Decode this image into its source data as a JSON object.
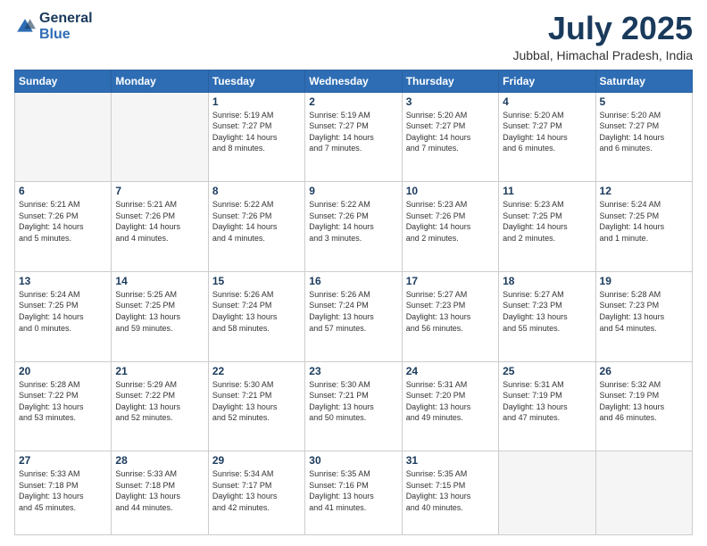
{
  "header": {
    "logo_line1": "General",
    "logo_line2": "Blue",
    "month": "July 2025",
    "location": "Jubbal, Himachal Pradesh, India"
  },
  "weekdays": [
    "Sunday",
    "Monday",
    "Tuesday",
    "Wednesday",
    "Thursday",
    "Friday",
    "Saturday"
  ],
  "weeks": [
    [
      {
        "day": "",
        "info": ""
      },
      {
        "day": "",
        "info": ""
      },
      {
        "day": "1",
        "info": "Sunrise: 5:19 AM\nSunset: 7:27 PM\nDaylight: 14 hours\nand 8 minutes."
      },
      {
        "day": "2",
        "info": "Sunrise: 5:19 AM\nSunset: 7:27 PM\nDaylight: 14 hours\nand 7 minutes."
      },
      {
        "day": "3",
        "info": "Sunrise: 5:20 AM\nSunset: 7:27 PM\nDaylight: 14 hours\nand 7 minutes."
      },
      {
        "day": "4",
        "info": "Sunrise: 5:20 AM\nSunset: 7:27 PM\nDaylight: 14 hours\nand 6 minutes."
      },
      {
        "day": "5",
        "info": "Sunrise: 5:20 AM\nSunset: 7:27 PM\nDaylight: 14 hours\nand 6 minutes."
      }
    ],
    [
      {
        "day": "6",
        "info": "Sunrise: 5:21 AM\nSunset: 7:26 PM\nDaylight: 14 hours\nand 5 minutes."
      },
      {
        "day": "7",
        "info": "Sunrise: 5:21 AM\nSunset: 7:26 PM\nDaylight: 14 hours\nand 4 minutes."
      },
      {
        "day": "8",
        "info": "Sunrise: 5:22 AM\nSunset: 7:26 PM\nDaylight: 14 hours\nand 4 minutes."
      },
      {
        "day": "9",
        "info": "Sunrise: 5:22 AM\nSunset: 7:26 PM\nDaylight: 14 hours\nand 3 minutes."
      },
      {
        "day": "10",
        "info": "Sunrise: 5:23 AM\nSunset: 7:26 PM\nDaylight: 14 hours\nand 2 minutes."
      },
      {
        "day": "11",
        "info": "Sunrise: 5:23 AM\nSunset: 7:25 PM\nDaylight: 14 hours\nand 2 minutes."
      },
      {
        "day": "12",
        "info": "Sunrise: 5:24 AM\nSunset: 7:25 PM\nDaylight: 14 hours\nand 1 minute."
      }
    ],
    [
      {
        "day": "13",
        "info": "Sunrise: 5:24 AM\nSunset: 7:25 PM\nDaylight: 14 hours\nand 0 minutes."
      },
      {
        "day": "14",
        "info": "Sunrise: 5:25 AM\nSunset: 7:25 PM\nDaylight: 13 hours\nand 59 minutes."
      },
      {
        "day": "15",
        "info": "Sunrise: 5:26 AM\nSunset: 7:24 PM\nDaylight: 13 hours\nand 58 minutes."
      },
      {
        "day": "16",
        "info": "Sunrise: 5:26 AM\nSunset: 7:24 PM\nDaylight: 13 hours\nand 57 minutes."
      },
      {
        "day": "17",
        "info": "Sunrise: 5:27 AM\nSunset: 7:23 PM\nDaylight: 13 hours\nand 56 minutes."
      },
      {
        "day": "18",
        "info": "Sunrise: 5:27 AM\nSunset: 7:23 PM\nDaylight: 13 hours\nand 55 minutes."
      },
      {
        "day": "19",
        "info": "Sunrise: 5:28 AM\nSunset: 7:23 PM\nDaylight: 13 hours\nand 54 minutes."
      }
    ],
    [
      {
        "day": "20",
        "info": "Sunrise: 5:28 AM\nSunset: 7:22 PM\nDaylight: 13 hours\nand 53 minutes."
      },
      {
        "day": "21",
        "info": "Sunrise: 5:29 AM\nSunset: 7:22 PM\nDaylight: 13 hours\nand 52 minutes."
      },
      {
        "day": "22",
        "info": "Sunrise: 5:30 AM\nSunset: 7:21 PM\nDaylight: 13 hours\nand 52 minutes."
      },
      {
        "day": "23",
        "info": "Sunrise: 5:30 AM\nSunset: 7:21 PM\nDaylight: 13 hours\nand 50 minutes."
      },
      {
        "day": "24",
        "info": "Sunrise: 5:31 AM\nSunset: 7:20 PM\nDaylight: 13 hours\nand 49 minutes."
      },
      {
        "day": "25",
        "info": "Sunrise: 5:31 AM\nSunset: 7:19 PM\nDaylight: 13 hours\nand 47 minutes."
      },
      {
        "day": "26",
        "info": "Sunrise: 5:32 AM\nSunset: 7:19 PM\nDaylight: 13 hours\nand 46 minutes."
      }
    ],
    [
      {
        "day": "27",
        "info": "Sunrise: 5:33 AM\nSunset: 7:18 PM\nDaylight: 13 hours\nand 45 minutes."
      },
      {
        "day": "28",
        "info": "Sunrise: 5:33 AM\nSunset: 7:18 PM\nDaylight: 13 hours\nand 44 minutes."
      },
      {
        "day": "29",
        "info": "Sunrise: 5:34 AM\nSunset: 7:17 PM\nDaylight: 13 hours\nand 42 minutes."
      },
      {
        "day": "30",
        "info": "Sunrise: 5:35 AM\nSunset: 7:16 PM\nDaylight: 13 hours\nand 41 minutes."
      },
      {
        "day": "31",
        "info": "Sunrise: 5:35 AM\nSunset: 7:15 PM\nDaylight: 13 hours\nand 40 minutes."
      },
      {
        "day": "",
        "info": ""
      },
      {
        "day": "",
        "info": ""
      }
    ]
  ]
}
